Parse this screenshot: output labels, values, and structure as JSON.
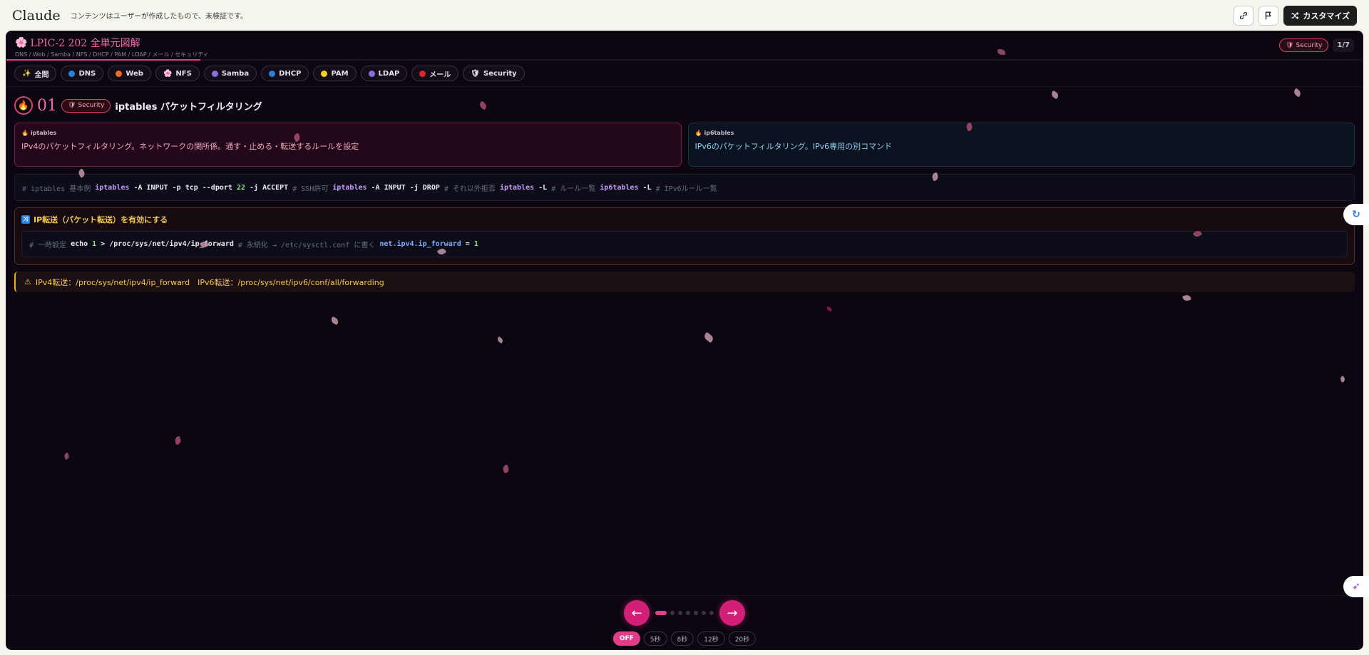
{
  "app": {
    "brand": "Claude",
    "notice": "コンテンツはユーザーが作成したもので、未検証です。",
    "customize_label": "カスタマイズ",
    "icons": [
      "link-icon",
      "flag-icon",
      "shuffle-icon"
    ]
  },
  "artifact": {
    "title": "LPIC-2 202 全単元図解",
    "subtitle": "DNS / Web / Samba / NFS / DHCP / PAM / LDAP / メール / セキュリティ",
    "badge": "Security",
    "page_count": "1/7",
    "progress": 0.143
  },
  "categories": [
    {
      "label": "全問",
      "icon": "sparkle-icon",
      "color": "#f5c84a"
    },
    {
      "label": "DNS",
      "icon": "dot",
      "color": "#2a7fd6"
    },
    {
      "label": "Web",
      "icon": "dot",
      "color": "#f26b1d"
    },
    {
      "label": "NFS",
      "icon": "flower-icon",
      "color": "#f06aa8"
    },
    {
      "label": "Samba",
      "icon": "dot",
      "color": "#8e6bdc"
    },
    {
      "label": "DHCP",
      "icon": "dot",
      "color": "#2a7fd6"
    },
    {
      "label": "PAM",
      "icon": "dot",
      "color": "#f5d21f"
    },
    {
      "label": "LDAP",
      "icon": "dot",
      "color": "#8e6bdc"
    },
    {
      "label": "メール",
      "icon": "dot",
      "color": "#e0262c"
    },
    {
      "label": "Security",
      "icon": "shield-icon",
      "color": "#d9435f"
    }
  ],
  "section": {
    "number": "01",
    "badge": "Security",
    "title": "iptables パケットフィルタリング"
  },
  "cards": [
    {
      "tag": "iptables",
      "text": "IPv4のパケットフィルタリング。ネットワークの関所係。通す・止める・転送するルールを設定"
    },
    {
      "tag": "ip6tables",
      "text": "IPv6のパケットフィルタリング。IPv6専用の別コマンド"
    }
  ],
  "code1": {
    "c1": "# iptables 基本例 ",
    "k1": "iptables",
    "o1": " -A INPUT -p tcp --dport ",
    "n1": "22",
    "o2": " -j ACCEPT ",
    "c2": "# SSH許可 ",
    "k2": "iptables",
    "o3": " -A INPUT -j DROP ",
    "c3": "# それ以外拒否 ",
    "k3": "iptables",
    "o4": " -L ",
    "c4": "# ルール一覧 ",
    "k4": "ip6tables",
    "o5": " -L ",
    "c5": "# IPv6ルール一覧"
  },
  "forward": {
    "title": "IP転送（パケット転送）を有効にする",
    "c1": "# 一時設定 ",
    "o1": "echo ",
    "n1": "1",
    "o2": " > /proc/sys/net/ipv4/ip_forward ",
    "c2": "# 永続化 → /etc/sysctl.conf に書く ",
    "b1": "net.ipv4.ip_forward",
    "o3": " = ",
    "n2": "1"
  },
  "warning": {
    "text": "IPv4転送：/proc/sys/net/ipv4/ip_forward　IPv6転送：/proc/sys/net/ipv6/conf/all/forwarding"
  },
  "footer": {
    "prev": "←",
    "next": "→",
    "page_dots": 7,
    "active_dot": 1,
    "speeds": [
      "OFF",
      "5秒",
      "8秒",
      "12秒",
      "20秒"
    ],
    "active_speed": "OFF"
  }
}
